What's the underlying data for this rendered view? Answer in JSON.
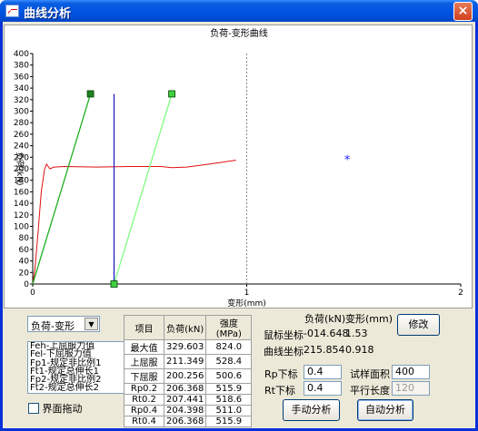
{
  "window": {
    "title": "曲线分析",
    "close_label": "×"
  },
  "chart_data": {
    "type": "line",
    "title": "负荷-变形曲线",
    "xlabel": "变形(mm)",
    "ylabel": "负荷(kN)",
    "xlim": [
      0,
      2
    ],
    "ylim": [
      0,
      400
    ],
    "x_ticks": [
      "0",
      "1",
      "2"
    ],
    "y_ticks": [
      "0",
      "20",
      "40",
      "60",
      "80",
      "100",
      "120",
      "140",
      "160",
      "180",
      "200",
      "220",
      "240",
      "260",
      "280",
      "300",
      "320",
      "340",
      "360",
      "380",
      "400"
    ],
    "grid": "dashed vertical line at x=1",
    "series": [
      {
        "color": "#e01010",
        "points": [
          [
            0.0,
            0
          ],
          [
            0.01,
            25
          ],
          [
            0.025,
            90
          ],
          [
            0.04,
            160
          ],
          [
            0.055,
            199
          ],
          [
            0.065,
            208
          ],
          [
            0.08,
            200
          ],
          [
            0.1,
            203
          ],
          [
            0.15,
            204
          ],
          [
            0.3,
            203
          ],
          [
            0.45,
            204
          ],
          [
            0.6,
            204
          ],
          [
            0.65,
            202
          ],
          [
            0.72,
            203
          ],
          [
            0.8,
            207
          ],
          [
            0.88,
            211
          ],
          [
            0.95,
            215
          ]
        ]
      },
      {
        "color": "#20b020",
        "points": [
          [
            0.0,
            0
          ],
          [
            0.27,
            330
          ]
        ]
      },
      {
        "color": "#80ff80",
        "points": [
          [
            0.38,
            0
          ],
          [
            0.65,
            330
          ]
        ]
      },
      {
        "color": "#2020c0",
        "points": [
          [
            0.38,
            0
          ],
          [
            0.38,
            330
          ]
        ]
      }
    ],
    "markers": [
      {
        "shape": "square",
        "color": "#208020",
        "x": 0.27,
        "y": 330
      },
      {
        "shape": "square",
        "color": "#40d040",
        "x": 0.65,
        "y": 330
      },
      {
        "shape": "square",
        "color": "#40d040",
        "x": 0.38,
        "y": 0
      },
      {
        "shape": "asterisk",
        "color": "#2020ff",
        "x": 1.47,
        "y": 215
      }
    ]
  },
  "mode_select": {
    "value": "负荷-变形",
    "arrow": "▼"
  },
  "legend_list": [
    "Feh-上屈服力值",
    "Fel-下屈服力值",
    "Fp1-规定非比例1",
    "Ft1-规定总伸长1",
    "Fp2-规定非比例2",
    "Ft2-规定总伸长2"
  ],
  "drag_checkbox": {
    "label": "界面拖动"
  },
  "results_table": {
    "headers": [
      "项目",
      "负荷(kN)",
      "强度(MPa)"
    ],
    "rows": [
      [
        "最大值",
        "329.603",
        "824.0"
      ],
      [
        "上屈服",
        "211.349",
        "528.4"
      ],
      [
        "下屈服",
        "200.256",
        "500.6"
      ],
      [
        "Rp0.2",
        "206.368",
        "515.9"
      ],
      [
        "Rt0.2",
        "207.441",
        "518.6"
      ],
      [
        "Rp0.4",
        "204.398",
        "511.0"
      ],
      [
        "Rt0.4",
        "206.368",
        "515.9"
      ]
    ]
  },
  "coords": {
    "load_header": "负荷(kN)",
    "deform_header": "变形(mm)",
    "mouse_label": "鼠标坐标",
    "mouse_load": "-014.648",
    "mouse_deform": "1.53",
    "curve_label": "曲线坐标",
    "curve_load": "215.854",
    "curve_deform": "0.918"
  },
  "params": {
    "rp_label": "Rp下标",
    "rp_value": "0.4",
    "rt_label": "Rt下标",
    "rt_value": "0.4",
    "area_label": "试样面积",
    "area_value": "400",
    "length_label": "平行长度",
    "length_value": "120"
  },
  "buttons": {
    "modify": "修改",
    "manual": "手动分析",
    "auto": "自动分析"
  }
}
